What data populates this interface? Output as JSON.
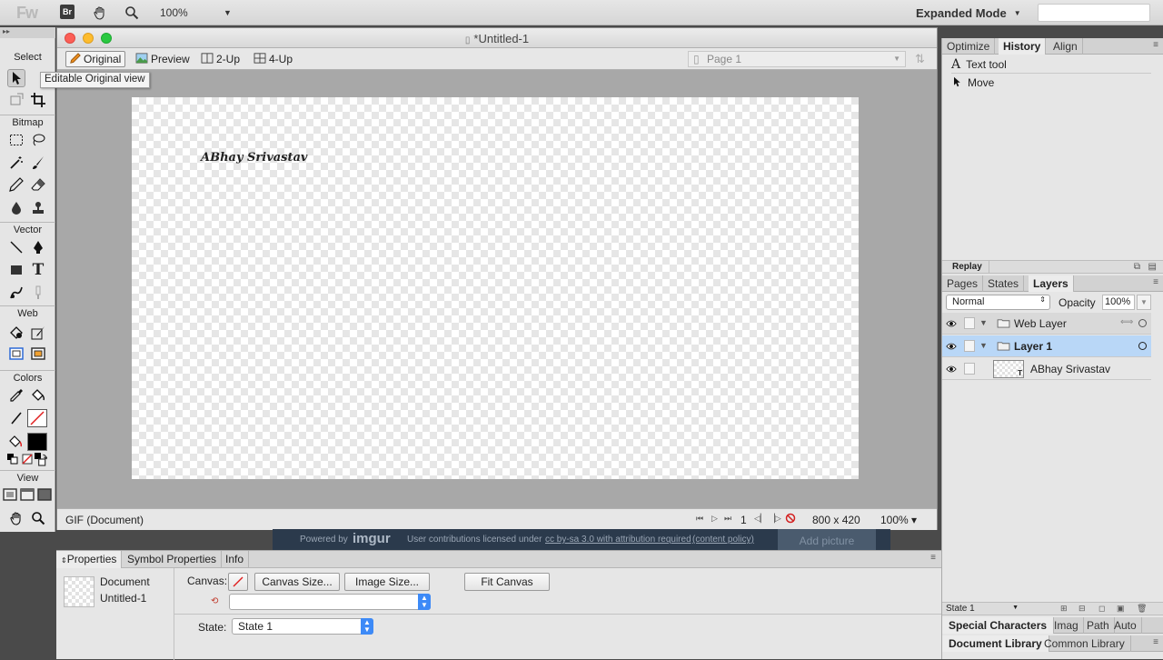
{
  "appbar": {
    "logo": "Fw",
    "bridge": "Br",
    "zoom": "100%",
    "mode": "Expanded Mode"
  },
  "tools": {
    "sections": [
      "Select",
      "Bitmap",
      "Vector",
      "Web",
      "Colors",
      "View"
    ],
    "tooltip": "Editable Original view"
  },
  "document": {
    "title": "*Untitled-1",
    "views": [
      "Original",
      "Preview",
      "2-Up",
      "4-Up"
    ],
    "page": "Page 1",
    "canvas_text": "ABhay Srivastav",
    "status_type": "GIF (Document)",
    "frame": "1",
    "size": "800 x 420",
    "zoom": "100%"
  },
  "imgur": {
    "powered": "Powered by",
    "brand": "imgur",
    "license": "User contributions licensed under",
    "license_link": "cc by-sa 3.0 with attribution required",
    "content_policy": "(content policy)",
    "add_picture": "Add picture"
  },
  "properties": {
    "tabs": [
      "Properties",
      "Symbol Properties",
      "Info"
    ],
    "doc_label": "Document",
    "doc_name": "Untitled-1",
    "canvas_label": "Canvas:",
    "canvas_size_btn": "Canvas Size...",
    "image_size_btn": "Image Size...",
    "fit_canvas_btn": "Fit Canvas",
    "state_label": "State:",
    "state_value": "State 1"
  },
  "history": {
    "tabs": [
      "Optimize",
      "History",
      "Align"
    ],
    "items": [
      "Text tool",
      "Move"
    ],
    "replay": "Replay"
  },
  "layers": {
    "tabs": [
      "Pages",
      "States",
      "Layers"
    ],
    "blend": "Normal",
    "opacity_label": "Opacity",
    "opacity": "100%",
    "rows": [
      "Web Layer",
      "Layer 1",
      "ABhay Srivastav"
    ],
    "state": "State 1"
  },
  "bottom_panels": {
    "row1": [
      "Special Characters",
      "Imag",
      "Path",
      "Auto"
    ],
    "row2": [
      "Document Library",
      "Common Library"
    ]
  }
}
